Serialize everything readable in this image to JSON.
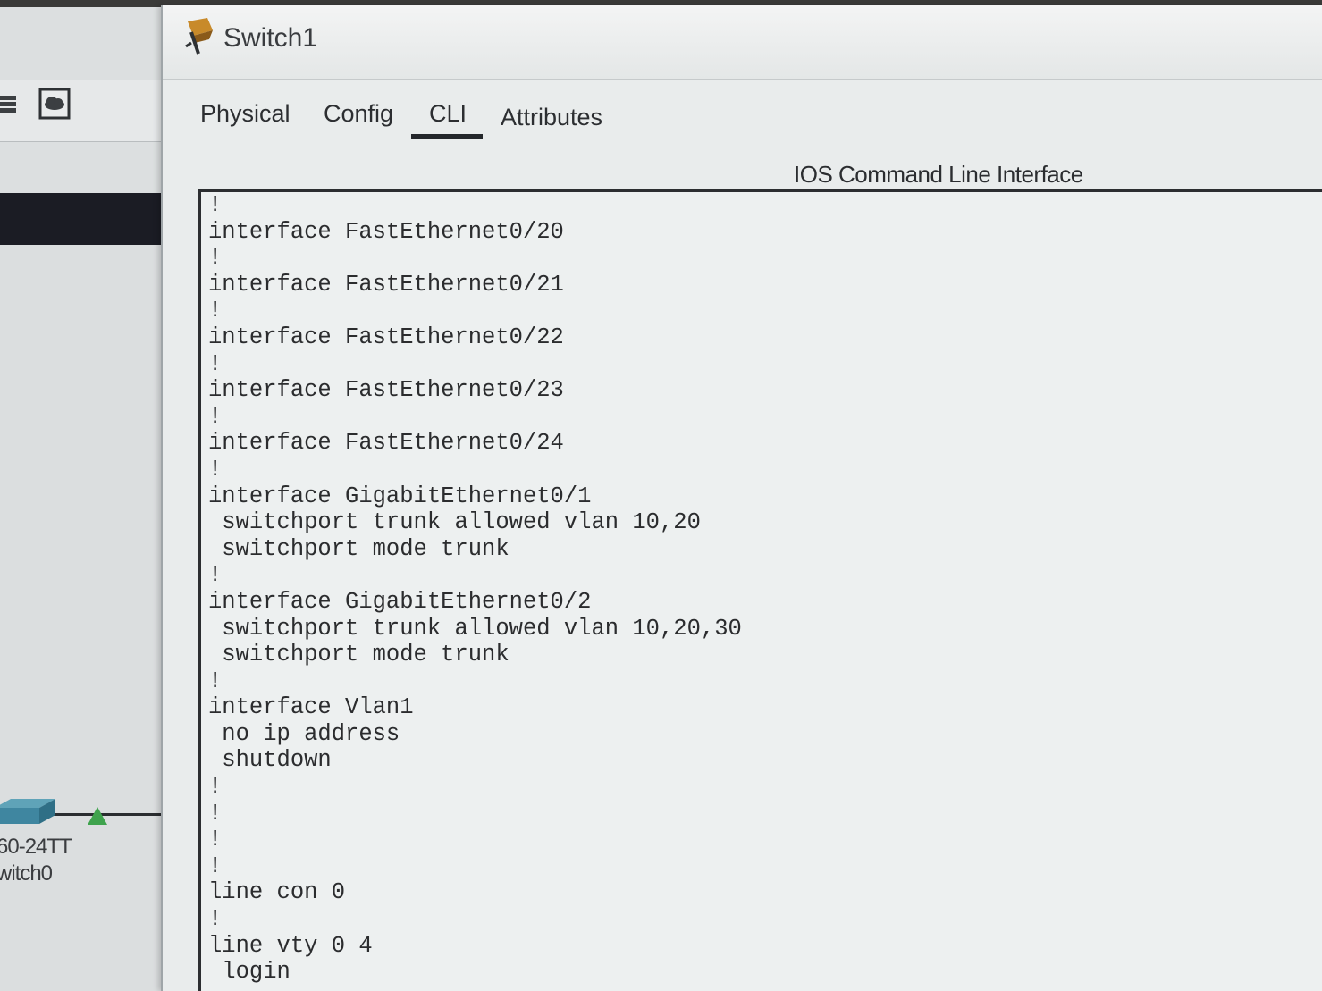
{
  "workspace": {
    "device": {
      "model": "60-24TT",
      "name": "witch0"
    }
  },
  "window": {
    "title": "Switch1",
    "tabs": [
      {
        "label": "Physical"
      },
      {
        "label": "Config"
      },
      {
        "label": "CLI",
        "selected": true
      },
      {
        "label": "Attributes"
      }
    ]
  },
  "cli": {
    "heading": "IOS Command Line Interface",
    "lines": [
      "!",
      "interface FastEthernet0/20",
      "!",
      "interface FastEthernet0/21",
      "!",
      "interface FastEthernet0/22",
      "!",
      "interface FastEthernet0/23",
      "!",
      "interface FastEthernet0/24",
      "!",
      "interface GigabitEthernet0/1",
      " switchport trunk allowed vlan 10,20",
      " switchport mode trunk",
      "!",
      "interface GigabitEthernet0/2",
      " switchport trunk allowed vlan 10,20,30",
      " switchport mode trunk",
      "!",
      "interface Vlan1",
      " no ip address",
      " shutdown",
      "!",
      "!",
      "!",
      "!",
      "line con 0",
      "!",
      "line vty 0 4",
      " login"
    ]
  },
  "colors": {
    "link_led": "#3fa34d",
    "terminal_bg": "#edf0f0",
    "terminal_text": "#2b2c2e",
    "selected_tab_underline": "#24272b"
  },
  "icons": {
    "title": "switch-device-icon",
    "toolbar": [
      "print-icon",
      "cloud-icon"
    ],
    "workspace": [
      "switch-icon",
      "link-led-icon"
    ]
  }
}
